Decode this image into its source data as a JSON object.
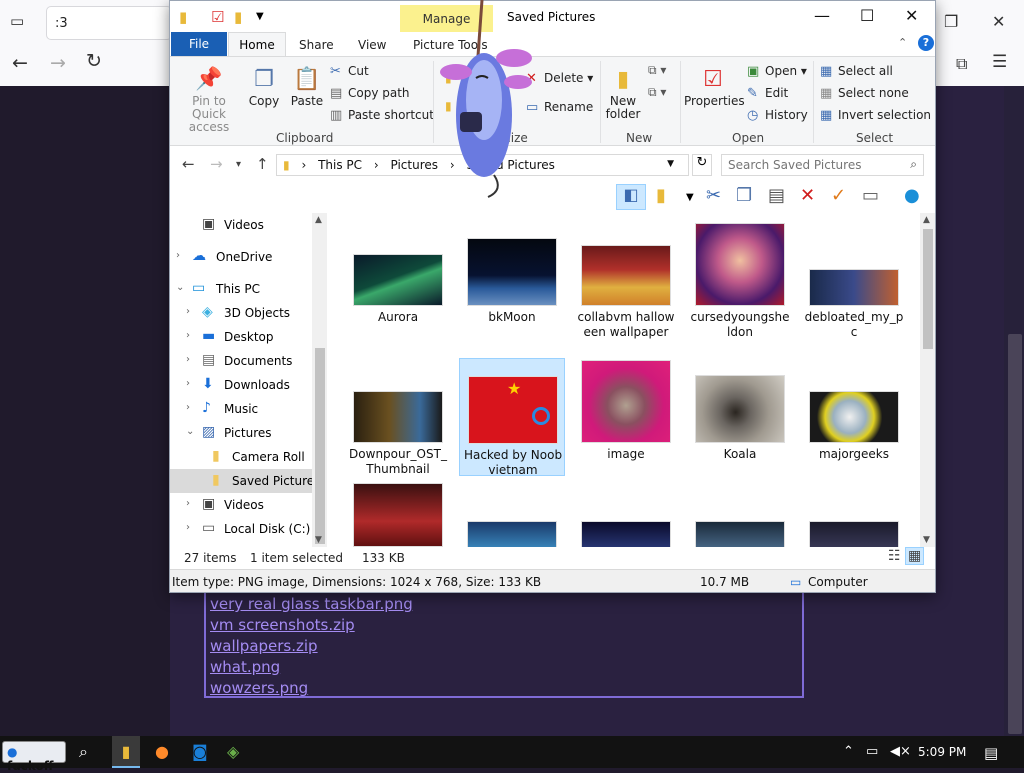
{
  "browser": {
    "tab_title": ":3",
    "files": [
      "very real glass taskbar.png",
      "vm screenshots.zip",
      "wallpapers.zip",
      "what.png",
      "wowzers.png"
    ]
  },
  "explorer": {
    "title": "Saved Pictures",
    "manage_label": "Manage",
    "tabs": {
      "file": "File",
      "home": "Home",
      "share": "Share",
      "view": "View",
      "picture_tools": "Picture Tools"
    },
    "ribbon": {
      "clipboard": {
        "label": "Clipboard",
        "pin": "Pin to Quick access",
        "copy": "Copy",
        "paste": "Paste",
        "cut": "Cut",
        "copy_path": "Copy path",
        "paste_shortcut": "Paste shortcut"
      },
      "organize": {
        "label": "Organize",
        "delete": "Delete",
        "rename": "Rename"
      },
      "new": {
        "label": "New",
        "new_folder": "New folder"
      },
      "open": {
        "label": "Open",
        "properties": "Properties",
        "open": "Open",
        "edit": "Edit",
        "history": "History"
      },
      "select": {
        "label": "Select",
        "select_all": "Select all",
        "select_none": "Select none",
        "invert": "Invert selection"
      }
    },
    "address": {
      "path": [
        "This PC",
        "Pictures",
        "Saved Pictures"
      ],
      "search_placeholder": "Search Saved Pictures"
    },
    "nav": [
      {
        "label": "Videos",
        "icon": "film-icon"
      },
      {
        "label": "OneDrive",
        "icon": "cloud-icon"
      },
      {
        "label": "This PC",
        "icon": "computer-icon"
      },
      {
        "label": "3D Objects",
        "icon": "cube-icon"
      },
      {
        "label": "Desktop",
        "icon": "desktop-icon"
      },
      {
        "label": "Documents",
        "icon": "document-icon"
      },
      {
        "label": "Downloads",
        "icon": "download-icon"
      },
      {
        "label": "Music",
        "icon": "music-icon"
      },
      {
        "label": "Pictures",
        "icon": "pictures-icon"
      },
      {
        "label": "Camera Roll",
        "icon": "folder-icon"
      },
      {
        "label": "Saved Pictures",
        "icon": "folder-icon"
      },
      {
        "label": "Videos",
        "icon": "film-icon"
      },
      {
        "label": "Local Disk (C:)",
        "icon": "drive-icon"
      }
    ],
    "files": [
      {
        "name": "Aurora"
      },
      {
        "name": "bkMoon"
      },
      {
        "name": "collabvm halloween wallpaper"
      },
      {
        "name": "cursedyoungsheldon"
      },
      {
        "name": "debloated_my_pc"
      },
      {
        "name": "Downpour_OST_Thumbnail"
      },
      {
        "name": "Hacked by Noob vietnam"
      },
      {
        "name": "image"
      },
      {
        "name": "Koala"
      },
      {
        "name": "majorgeeks"
      }
    ],
    "status": {
      "items": "27 items",
      "selected": "1 item selected",
      "size": "133 KB"
    },
    "details": {
      "info": "Item type: PNG image, Dimensions: 1024 x 768, Size: 133 KB",
      "total": "10.7 MB",
      "location": "Computer"
    }
  },
  "taskbar": {
    "start_label": "fuckoff",
    "time": "5:09 PM"
  }
}
